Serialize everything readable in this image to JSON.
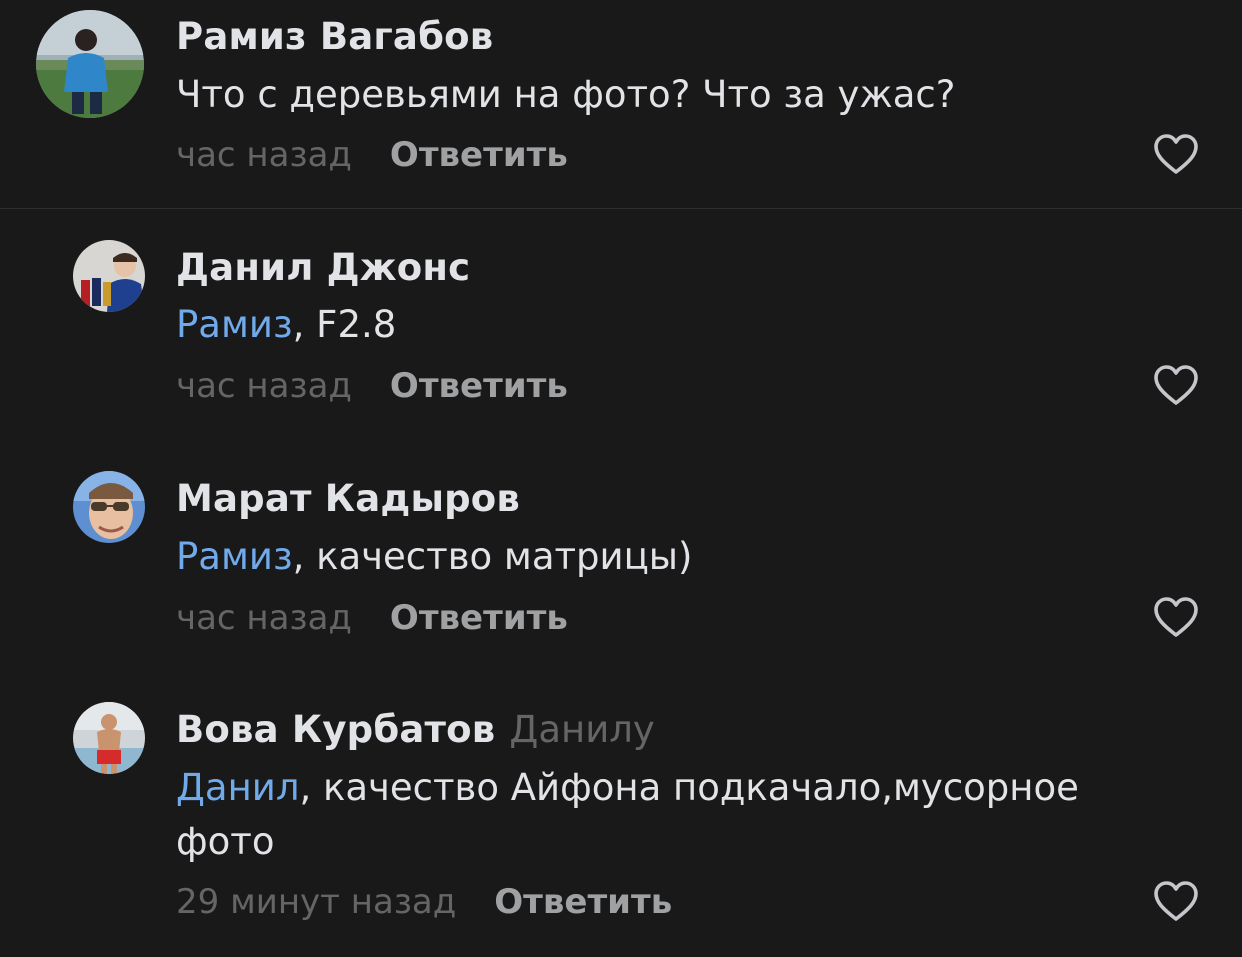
{
  "comments": [
    {
      "author": "Рамиз Вагабов",
      "reply_to": "",
      "mention": "",
      "separator": "",
      "text": "Что с деревьями на фото? Что за ужас?",
      "time": "час назад",
      "reply_label": "Ответить"
    },
    {
      "author": "Данил Джонс",
      "reply_to": "",
      "mention": "Рамиз",
      "separator": ", ",
      "text": "F2.8",
      "time": "час назад",
      "reply_label": "Ответить"
    },
    {
      "author": "Марат Кадыров",
      "reply_to": "",
      "mention": "Рамиз",
      "separator": ", ",
      "text": "качество матрицы)",
      "time": "час назад",
      "reply_label": "Ответить"
    },
    {
      "author": "Вова Курбатов",
      "reply_to": "Данилу",
      "mention": "Данил",
      "separator": ", ",
      "text": "качество Айфона подкачало,мусорное фото",
      "time": "29 минут назад",
      "reply_label": "Ответить"
    }
  ],
  "icons": {
    "like": "heart-outline-icon"
  },
  "colors": {
    "background": "#19191a",
    "text": "#e1e3e6",
    "mention": "#71aaeb",
    "secondary": "#656565",
    "action": "#a0a1a3",
    "divider": "#2e2e30"
  }
}
